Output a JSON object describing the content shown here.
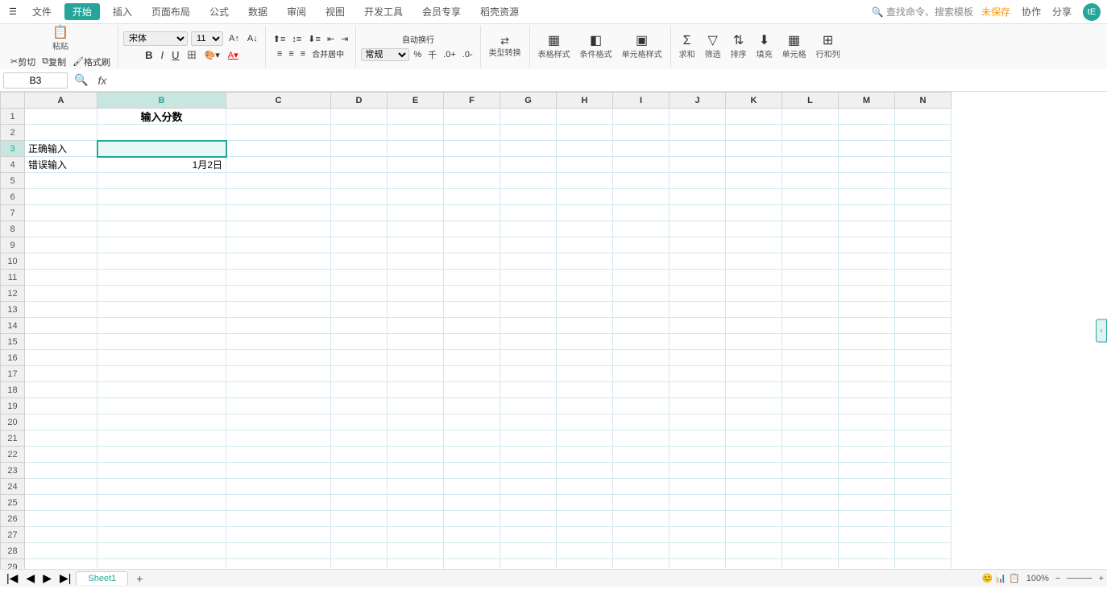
{
  "titlebar": {
    "menu_icon": "☰",
    "file_label": "文件",
    "icons": [
      "📋",
      "🖨",
      "↩",
      "↪",
      "▾"
    ],
    "start_label": "开始",
    "insert_label": "插入",
    "layout_label": "页面布局",
    "formula_label": "公式",
    "data_label": "数据",
    "review_label": "审阅",
    "view_label": "视图",
    "devtools_label": "开发工具",
    "member_label": "会员专享",
    "template_label": "稻壳资源",
    "search_placeholder": "查找命令、搜索模板",
    "unsaved_label": "未保存",
    "collab_label": "协作",
    "share_label": "分享",
    "user_label": "tE"
  },
  "toolbar": {
    "paste_label": "粘贴",
    "cut_label": "剪切",
    "copy_label": "复制",
    "format_label": "格式刷",
    "font_name": "宋体",
    "font_size": "11",
    "bold_label": "B",
    "italic_label": "I",
    "underline_label": "U",
    "border_label": "田",
    "fill_label": "▾",
    "font_color_label": "A",
    "align_left": "≡",
    "align_center": "≡",
    "align_right": "≡",
    "indent_decrease": "⇤",
    "indent_increase": "⇥",
    "wrap_label": "合并居中",
    "auto_convert": "自动换行",
    "format_num": "常规",
    "percent": "%",
    "thousand": ",",
    "increase_decimal": ".0+",
    "decrease_decimal": ".0-",
    "type_convert": "类型转换",
    "table_style_label": "表格样式",
    "conditional_label": "条件格式",
    "cell_style_label": "单元格样式",
    "sum_label": "求和",
    "filter_label": "筛选",
    "sort_label": "排序",
    "fill_down_label": "填充",
    "cell_label": "单元格",
    "row_col_label": "行和列"
  },
  "formulabar": {
    "cell_ref": "B3",
    "formula_content": ""
  },
  "grid": {
    "columns": [
      "A",
      "B",
      "C",
      "D",
      "E",
      "F",
      "G",
      "H",
      "I",
      "J",
      "K",
      "L",
      "M",
      "N"
    ],
    "active_col": "B",
    "active_row": 3,
    "merged_header": {
      "row": 1,
      "col": "B",
      "text": "输入分数"
    },
    "cells": {
      "A3": "正确输入",
      "A4": "错误输入",
      "B3": "",
      "B4": "1月2日"
    }
  },
  "sheets": {
    "tabs": [
      "Sheet1"
    ],
    "active": "Sheet1",
    "add_label": "+"
  },
  "statusbar": {
    "zoom_label": "100%"
  }
}
